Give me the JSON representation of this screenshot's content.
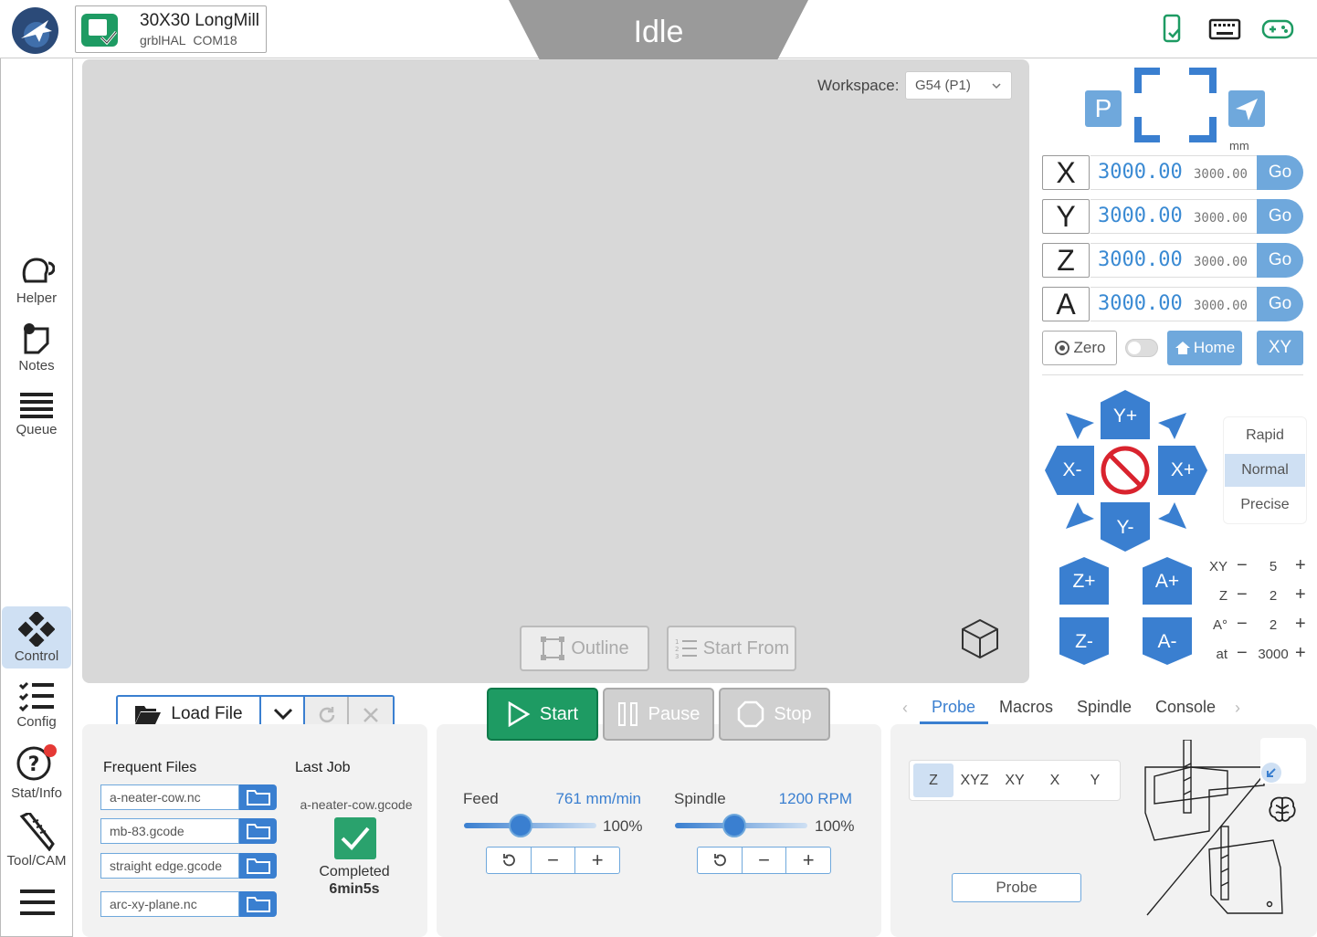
{
  "header": {
    "machine_name": "30X30 LongMill",
    "firmware": "grblHAL",
    "port": "COM18",
    "status": "Idle"
  },
  "sidebar": {
    "items": [
      {
        "label": "Helper"
      },
      {
        "label": "Notes"
      },
      {
        "label": "Queue"
      },
      {
        "label": "Control"
      },
      {
        "label": "Config"
      },
      {
        "label": "Stat/Info"
      },
      {
        "label": "Tool/CAM"
      }
    ]
  },
  "visualizer": {
    "workspace_label": "Workspace:",
    "workspace_value": "G54 (P1)",
    "outline_label": "Outline",
    "start_from_label": "Start From"
  },
  "dro": {
    "park_label": "P",
    "units": "mm",
    "axes": [
      {
        "name": "X",
        "work": "3000.00",
        "machine": "3000.00",
        "go": "Go"
      },
      {
        "name": "Y",
        "work": "3000.00",
        "machine": "3000.00",
        "go": "Go"
      },
      {
        "name": "Z",
        "work": "3000.00",
        "machine": "3000.00",
        "go": "Go"
      },
      {
        "name": "A",
        "work": "3000.00",
        "machine": "3000.00",
        "go": "Go"
      }
    ],
    "zero_label": "Zero",
    "home_label": "Home",
    "xy_label": "XY"
  },
  "jog": {
    "yplus": "Y+",
    "yminus": "Y-",
    "xplus": "X+",
    "xminus": "X-",
    "zplus": "Z+",
    "zminus": "Z-",
    "aplus": "A+",
    "aminus": "A-",
    "modes": [
      "Rapid",
      "Normal",
      "Precise"
    ],
    "active_mode": "Normal",
    "increments": [
      {
        "label": "XY",
        "value": "5"
      },
      {
        "label": "Z",
        "value": "2"
      },
      {
        "label": "A°",
        "value": "2"
      },
      {
        "label": "at",
        "value": "3000"
      }
    ]
  },
  "files": {
    "load_label": "Load File",
    "frequent_title": "Frequent Files",
    "frequent": [
      "a-neater-cow.nc",
      "mb-83.gcode",
      "straight edge.gcode",
      "arc-xy-plane.nc"
    ],
    "last_job_title": "Last Job",
    "last_job_file": "a-neater-cow.gcode",
    "last_job_status": "Completed",
    "last_job_time": "6min5s"
  },
  "job": {
    "start": "Start",
    "pause": "Pause",
    "stop": "Stop"
  },
  "overrides": {
    "feed_label": "Feed",
    "feed_value": "761 mm/min",
    "feed_pct": "100%",
    "feed_fraction": 0.43,
    "spindle_label": "Spindle",
    "spindle_value": "1200 RPM",
    "spindle_pct": "100%",
    "spindle_fraction": 0.45
  },
  "tools": {
    "tabs": [
      "Probe",
      "Macros",
      "Spindle",
      "Console"
    ],
    "active_tab": "Probe",
    "probe_axes": [
      "Z",
      "XYZ",
      "XY",
      "X",
      "Y"
    ],
    "probe_active": "Z",
    "probe_button": "Probe"
  },
  "colors": {
    "accent": "#3a7fd0",
    "start_green": "#1e9b63",
    "status_gray": "#9a9a9a",
    "notify_red": "#e53935"
  }
}
